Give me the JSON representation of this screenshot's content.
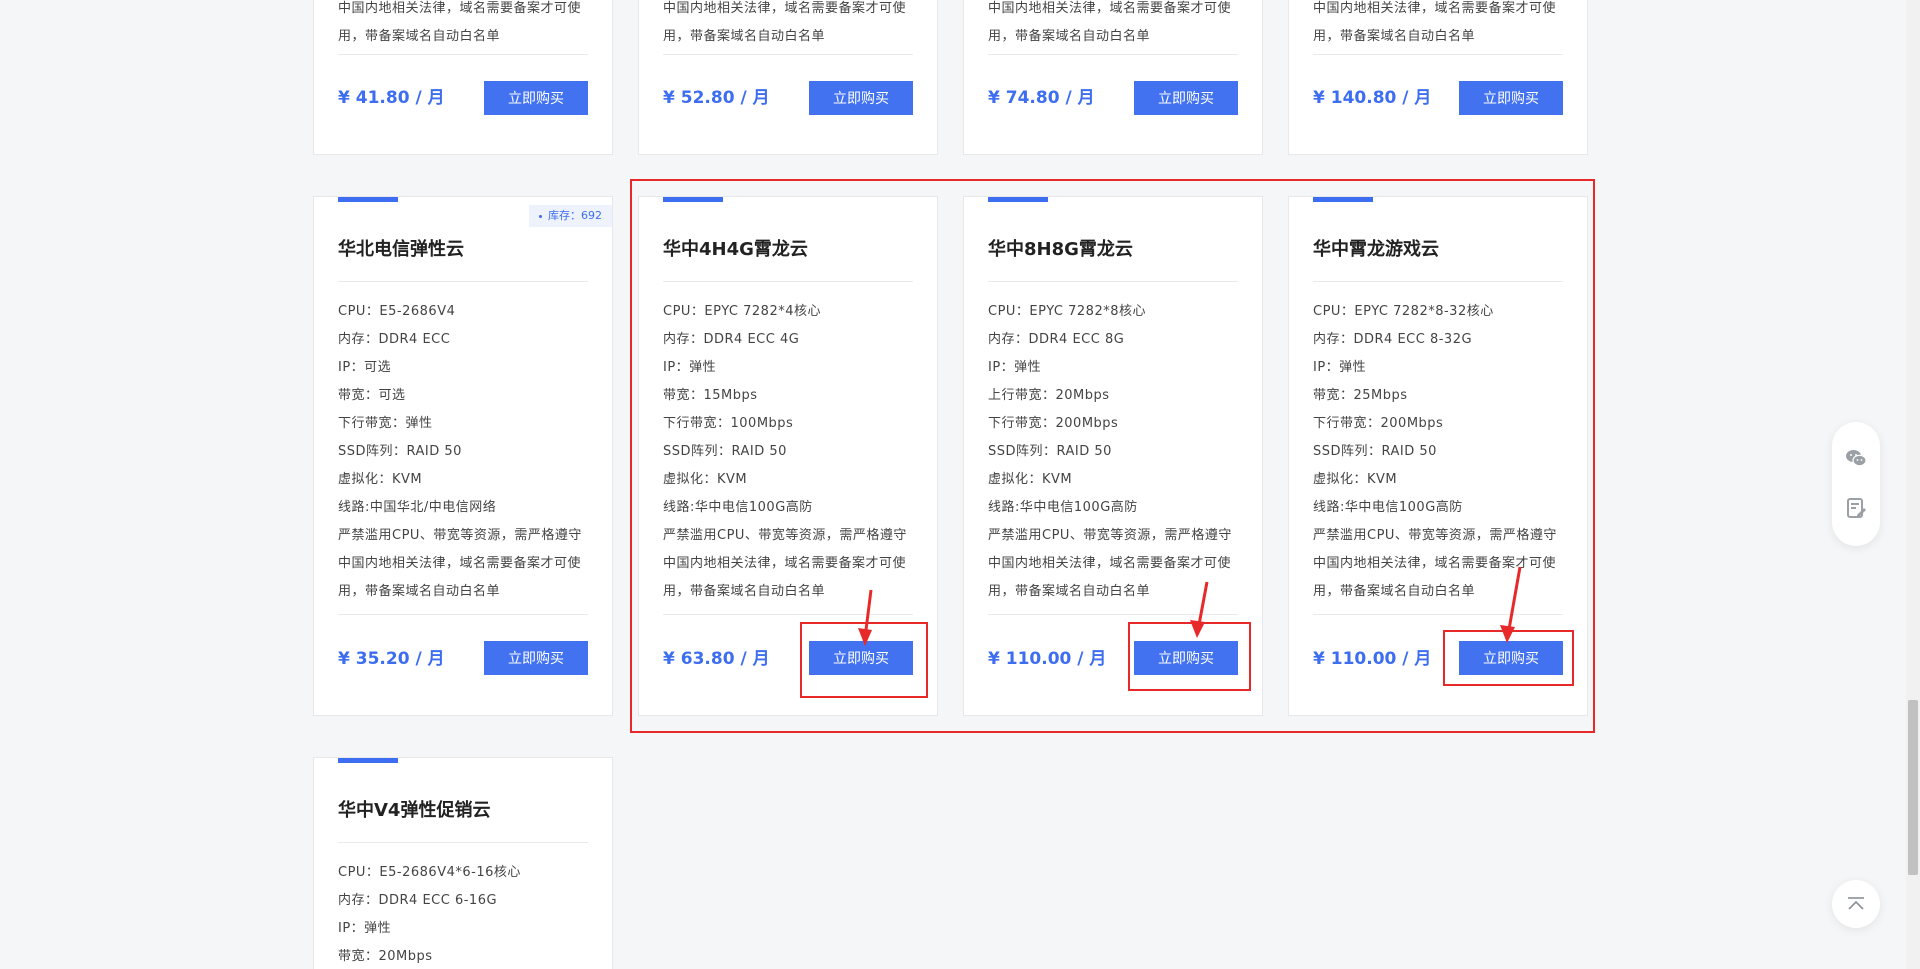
{
  "top_row": [
    {
      "desc_tail": [
        "中国内地相关法律，域名需要备案才可使",
        "用，带备案域名自动白名单"
      ],
      "price": "¥ 41.80 / 月",
      "buy_label": "立即购买"
    },
    {
      "desc_tail": [
        "中国内地相关法律，域名需要备案才可使",
        "用，带备案域名自动白名单"
      ],
      "price": "¥ 52.80 / 月",
      "buy_label": "立即购买"
    },
    {
      "desc_tail": [
        "中国内地相关法律，域名需要备案才可使",
        "用，带备案域名自动白名单"
      ],
      "price": "¥ 74.80 / 月",
      "buy_label": "立即购买"
    },
    {
      "desc_tail": [
        "中国内地相关法律，域名需要备案才可使",
        "用，带备案域名自动白名单"
      ],
      "price": "¥ 140.80 / 月",
      "buy_label": "立即购买"
    }
  ],
  "middle_row": [
    {
      "title": "华北电信弹性云",
      "stock": "库存：692",
      "specs": [
        "CPU：E5-2686V4",
        "内存：DDR4 ECC",
        "IP：可选",
        "带宽：可选",
        "下行带宽：弹性",
        "SSD阵列：RAID 50",
        "虚拟化：KVM",
        "线路:中国华北/中电信网络",
        "严禁滥用CPU、带宽等资源，需严格遵守",
        "中国内地相关法律，域名需要备案才可使",
        "用，带备案域名自动白名单"
      ],
      "price": "¥ 35.20 / 月",
      "buy_label": "立即购买"
    },
    {
      "title": "华中4H4G霄龙云",
      "specs": [
        "CPU：EPYC 7282*4核心",
        "内存：DDR4 ECC 4G",
        "IP：弹性",
        "带宽：15Mbps",
        "下行带宽：100Mbps",
        "SSD阵列：RAID 50",
        "虚拟化：KVM",
        "线路:华中电信100G高防",
        "严禁滥用CPU、带宽等资源，需严格遵守",
        "中国内地相关法律，域名需要备案才可使",
        "用，带备案域名自动白名单"
      ],
      "price": "¥ 63.80 / 月",
      "buy_label": "立即购买"
    },
    {
      "title": "华中8H8G霄龙云",
      "specs": [
        "CPU：EPYC 7282*8核心",
        "内存：DDR4 ECC 8G",
        "IP：弹性",
        "上行带宽：20Mbps",
        "下行带宽：200Mbps",
        "SSD阵列：RAID 50",
        "虚拟化：KVM",
        "线路:华中电信100G高防",
        "严禁滥用CPU、带宽等资源，需严格遵守",
        "中国内地相关法律，域名需要备案才可使",
        "用，带备案域名自动白名单"
      ],
      "price": "¥ 110.00 / 月",
      "buy_label": "立即购买"
    },
    {
      "title": "华中霄龙游戏云",
      "specs": [
        "CPU：EPYC 7282*8-32核心",
        "内存：DDR4 ECC 8-32G",
        "IP：弹性",
        "带宽：25Mbps",
        "下行带宽：200Mbps",
        "SSD阵列：RAID 50",
        "虚拟化：KVM",
        "线路:华中电信100G高防",
        "严禁滥用CPU、带宽等资源，需严格遵守",
        "中国内地相关法律，域名需要备案才可使",
        "用，带备案域名自动白名单"
      ],
      "price": "¥ 110.00 / 月",
      "buy_label": "立即购买"
    }
  ],
  "bottom_row": [
    {
      "title": "华中V4弹性促销云",
      "specs": [
        "CPU：E5-2686V4*6-16核心",
        "内存：DDR4 ECC 6-16G",
        "IP：弹性",
        "带宽：20Mbps"
      ]
    }
  ],
  "colors": {
    "accent": "#3d6df0",
    "button": "#4272f0",
    "annotation": "#e82929"
  },
  "floating": {
    "icons": [
      "wechat-icon",
      "feedback-icon"
    ],
    "top_icon": "back-to-top-icon"
  }
}
